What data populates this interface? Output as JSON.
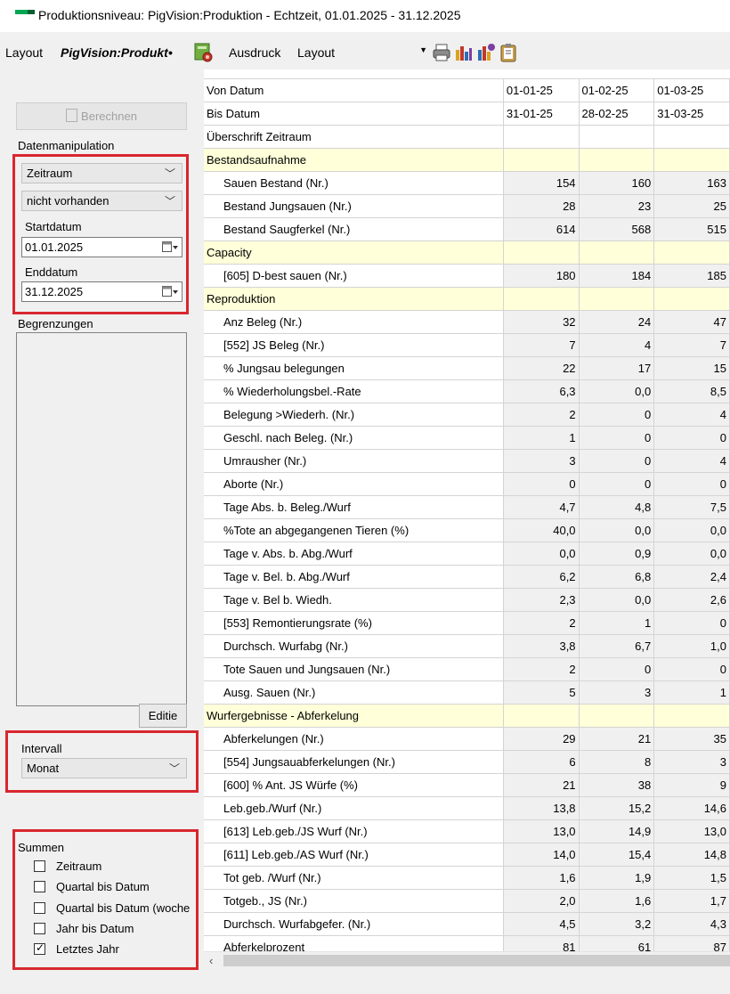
{
  "window": {
    "title": "Produktionsniveau: PigVision:Produktion - Echtzeit, 01.01.2025 - 31.12.2025"
  },
  "toolbar": {
    "layout_label": "Layout",
    "layout_value": "PigVision:Produkt•",
    "print_label": "Ausdruck",
    "print_value": "Layout"
  },
  "left": {
    "calculate_button": "Berechnen",
    "group_label": "Datenmanipulation",
    "period_select": "Zeitraum",
    "existence_select": "nicht vorhanden",
    "start_label": "Startdatum",
    "start_value": "01.01.2025",
    "end_label": "Enddatum",
    "end_value": "31.12.2025",
    "limits_label": "Begrenzungen",
    "edit_button": "Editie",
    "interval_label": "Intervall",
    "interval_value": "Monat",
    "sums_label": "Summen",
    "sums": [
      {
        "label": "Zeitraum",
        "checked": false
      },
      {
        "label": "Quartal bis Datum",
        "checked": false
      },
      {
        "label": "Quartal bis Datum (woche",
        "checked": false
      },
      {
        "label": "Jahr bis Datum",
        "checked": false
      },
      {
        "label": "Letztes Jahr",
        "checked": true
      }
    ]
  },
  "grid": {
    "rows": [
      {
        "type": "header",
        "label": "Von Datum",
        "values": [
          "01-01-25",
          "01-02-25",
          "01-03-25"
        ]
      },
      {
        "type": "header",
        "label": "Bis Datum",
        "values": [
          "31-01-25",
          "28-02-25",
          "31-03-25"
        ]
      },
      {
        "type": "header",
        "label": "Überschrift Zeitraum",
        "values": [
          "",
          "",
          ""
        ]
      },
      {
        "type": "section",
        "label": "Bestandsaufnahme",
        "values": [
          "",
          "",
          ""
        ]
      },
      {
        "type": "data",
        "label": "Sauen Bestand (Nr.)",
        "values": [
          "154",
          "160",
          "163"
        ]
      },
      {
        "type": "data",
        "label": "Bestand Jungsauen (Nr.)",
        "values": [
          "28",
          "23",
          "25"
        ]
      },
      {
        "type": "data",
        "label": "Bestand Saugferkel (Nr.)",
        "values": [
          "614",
          "568",
          "515"
        ]
      },
      {
        "type": "section",
        "label": "Capacity",
        "values": [
          "",
          "",
          ""
        ]
      },
      {
        "type": "data",
        "label": "[605] D-best sauen (Nr.)",
        "values": [
          "180",
          "184",
          "185"
        ]
      },
      {
        "type": "section",
        "label": "Reproduktion",
        "values": [
          "",
          "",
          ""
        ]
      },
      {
        "type": "data",
        "label": "Anz Beleg (Nr.)",
        "values": [
          "32",
          "24",
          "47"
        ]
      },
      {
        "type": "data",
        "label": "[552] JS Beleg (Nr.)",
        "values": [
          "7",
          "4",
          "7"
        ]
      },
      {
        "type": "data",
        "label": "% Jungsau belegungen",
        "values": [
          "22",
          "17",
          "15"
        ]
      },
      {
        "type": "data",
        "label": "% Wiederholungsbel.-Rate",
        "values": [
          "6,3",
          "0,0",
          "8,5"
        ]
      },
      {
        "type": "data",
        "label": "Belegung >Wiederh. (Nr.)",
        "values": [
          "2",
          "0",
          "4"
        ]
      },
      {
        "type": "data",
        "label": "Geschl. nach Beleg. (Nr.)",
        "values": [
          "1",
          "0",
          "0"
        ]
      },
      {
        "type": "data",
        "label": "Umrausher (Nr.)",
        "values": [
          "3",
          "0",
          "4"
        ]
      },
      {
        "type": "data",
        "label": "Aborte (Nr.)",
        "values": [
          "0",
          "0",
          "0"
        ]
      },
      {
        "type": "data",
        "label": "Tage Abs. b. Beleg./Wurf",
        "values": [
          "4,7",
          "4,8",
          "7,5"
        ]
      },
      {
        "type": "data",
        "label": "%Tote an abgegangenen Tieren (%)",
        "values": [
          "40,0",
          "0,0",
          "0,0"
        ]
      },
      {
        "type": "data",
        "label": "Tage v. Abs. b. Abg./Wurf",
        "values": [
          "0,0",
          "0,9",
          "0,0"
        ]
      },
      {
        "type": "data",
        "label": "Tage v. Bel. b. Abg./Wurf",
        "values": [
          "6,2",
          "6,8",
          "2,4"
        ]
      },
      {
        "type": "data",
        "label": "Tage v. Bel b. Wiedh.",
        "values": [
          "2,3",
          "0,0",
          "2,6"
        ]
      },
      {
        "type": "data",
        "label": "[553] Remontierungsrate (%)",
        "values": [
          "2",
          "1",
          "0"
        ]
      },
      {
        "type": "data",
        "label": "Durchsch. Wurfabg (Nr.)",
        "values": [
          "3,8",
          "6,7",
          "1,0"
        ]
      },
      {
        "type": "data",
        "label": "Tote Sauen und Jungsauen (Nr.)",
        "values": [
          "2",
          "0",
          "0"
        ]
      },
      {
        "type": "data",
        "label": "Ausg. Sauen (Nr.)",
        "values": [
          "5",
          "3",
          "1"
        ]
      },
      {
        "type": "section",
        "label": "Wurfergebnisse - Abferkelung",
        "values": [
          "",
          "",
          ""
        ]
      },
      {
        "type": "data",
        "label": "Abferkelungen (Nr.)",
        "values": [
          "29",
          "21",
          "35"
        ]
      },
      {
        "type": "data",
        "label": "[554] Jungsauabferkelungen (Nr.)",
        "values": [
          "6",
          "8",
          "3"
        ]
      },
      {
        "type": "data",
        "label": "[600] % Ant. JS Würfe (%)",
        "values": [
          "21",
          "38",
          "9"
        ]
      },
      {
        "type": "data",
        "label": "Leb.geb./Wurf (Nr.)",
        "values": [
          "13,8",
          "15,2",
          "14,6"
        ]
      },
      {
        "type": "data",
        "label": "[613] Leb.geb./JS Wurf (Nr.)",
        "values": [
          "13,0",
          "14,9",
          "13,0"
        ]
      },
      {
        "type": "data",
        "label": "[611] Leb.geb./AS Wurf (Nr.)",
        "values": [
          "14,0",
          "15,4",
          "14,8"
        ]
      },
      {
        "type": "data",
        "label": "Tot geb. /Wurf (Nr.)",
        "values": [
          "1,6",
          "1,9",
          "1,5"
        ]
      },
      {
        "type": "data",
        "label": "Totgeb., JS (Nr.)",
        "values": [
          "2,0",
          "1,6",
          "1,7"
        ]
      },
      {
        "type": "data",
        "label": "Durchsch. Wurfabgefer. (Nr.)",
        "values": [
          "4,5",
          "3,2",
          "4,3"
        ]
      },
      {
        "type": "data",
        "label": "Abferkelprozent",
        "values": [
          "81",
          "61",
          "87"
        ]
      }
    ]
  }
}
